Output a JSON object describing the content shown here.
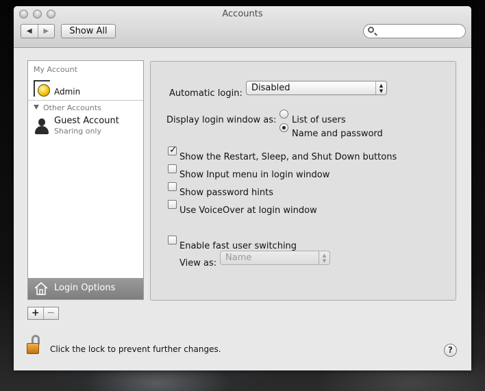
{
  "window": {
    "title": "Accounts"
  },
  "toolbar": {
    "back_icon": "◀",
    "forward_icon": "▶",
    "show_all_label": "Show All",
    "search_value": "",
    "search_placeholder": ""
  },
  "sidebar": {
    "my_account_header": "My Account",
    "admin_name": "Admin",
    "other_accounts_header": "Other Accounts",
    "guest_name": "Guest Account",
    "guest_sub": "Sharing only",
    "login_options_label": "Login Options",
    "add_label": "+",
    "remove_label": "−"
  },
  "login_panel": {
    "automatic_login_label": "Automatic login:",
    "automatic_login_value": "Disabled",
    "display_as_label": "Display login window as:",
    "radio_list_label": "List of users",
    "radio_list_selected": false,
    "radio_name_label": "Name and password",
    "radio_name_selected": true,
    "checkbox_restart_label": "Show the Restart, Sleep, and Shut Down buttons",
    "checkbox_restart_checked": true,
    "checkbox_input_label": "Show Input menu in login window",
    "checkbox_input_checked": false,
    "checkbox_hints_label": "Show password hints",
    "checkbox_hints_checked": false,
    "checkbox_voiceover_label": "Use VoiceOver at login window",
    "checkbox_voiceover_checked": false,
    "checkbox_fast_label": "Enable fast user switching",
    "checkbox_fast_checked": false,
    "view_as_label": "View as:",
    "view_as_value": "Name"
  },
  "footer": {
    "lock_text": "Click the lock to prevent further changes.",
    "help_label": "?"
  }
}
